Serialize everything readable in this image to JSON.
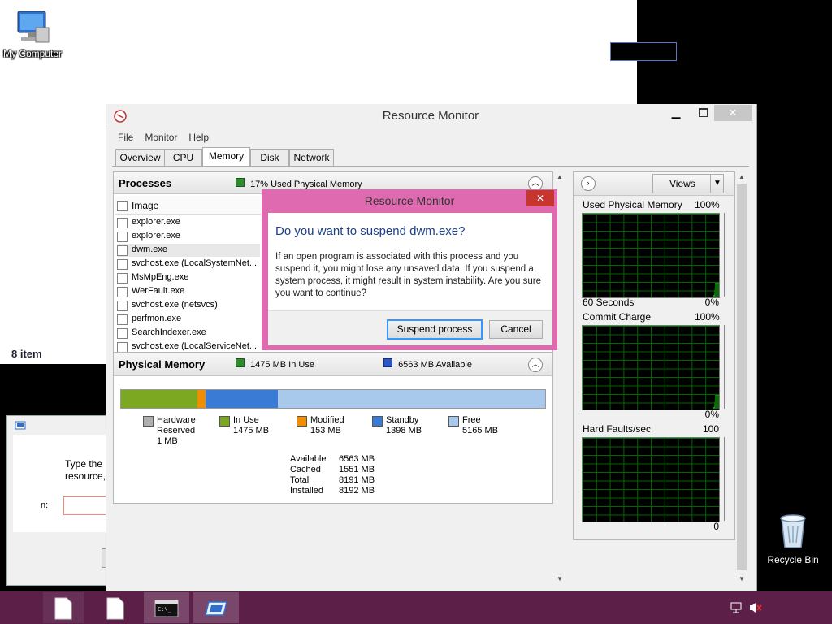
{
  "desktop": {
    "my_computer_label": "My Computer",
    "recycle_bin_label": "Recycle Bin",
    "status_text": "8 item",
    "run_dialog": {
      "prompt_line1": "Type the r",
      "prompt_line2": "resource,",
      "field_label": "n:"
    }
  },
  "window": {
    "title": "Resource Monitor",
    "menu": [
      "File",
      "Monitor",
      "Help"
    ],
    "tabs": [
      "Overview",
      "CPU",
      "Memory",
      "Disk",
      "Network"
    ],
    "active_tab": "Memory"
  },
  "processes": {
    "title": "Processes",
    "summary": "17% Used Physical Memory",
    "column_header": "Image",
    "rows": [
      "explorer.exe",
      "explorer.exe",
      "dwm.exe",
      "svchost.exe (LocalSystemNet...",
      "MsMpEng.exe",
      "WerFault.exe",
      "svchost.exe (netsvcs)",
      "perfmon.exe",
      "SearchIndexer.exe",
      "svchost.exe (LocalServiceNet..."
    ]
  },
  "physical_memory": {
    "title": "Physical Memory",
    "in_use_summary": "1475 MB In Use",
    "available_summary": "6563 MB Available",
    "bar": [
      {
        "label": "Hardware Reserved",
        "mb": 1,
        "color": "#a6a6a6"
      },
      {
        "label": "In Use",
        "mb": 1475,
        "color": "#7ba820"
      },
      {
        "label": "Modified",
        "mb": 153,
        "color": "#f28c00"
      },
      {
        "label": "Standby",
        "mb": 1398,
        "color": "#3a7bd5"
      },
      {
        "label": "Free",
        "mb": 5165,
        "color": "#a9c9ec"
      }
    ],
    "legend": [
      {
        "name": "Hardware\nReserved",
        "value": "1 MB",
        "color": "#b0b0b0"
      },
      {
        "name": "In Use",
        "value": "1475 MB",
        "color": "#7ba820"
      },
      {
        "name": "Modified",
        "value": "153 MB",
        "color": "#f28c00"
      },
      {
        "name": "Standby",
        "value": "1398 MB",
        "color": "#3a7bd5"
      },
      {
        "name": "Free",
        "value": "5165 MB",
        "color": "#a9c9ec"
      }
    ],
    "stats": [
      {
        "label": "Available",
        "value": "6563 MB"
      },
      {
        "label": "Cached",
        "value": "1551 MB"
      },
      {
        "label": "Total",
        "value": "8191 MB"
      },
      {
        "label": "Installed",
        "value": "8192 MB"
      }
    ]
  },
  "right_panel": {
    "views_label": "Views",
    "graphs": [
      {
        "title": "Used Physical Memory",
        "top_value": "100%",
        "bottom_left": "60 Seconds",
        "bottom_value": "0%"
      },
      {
        "title": "Commit Charge",
        "top_value": "100%",
        "bottom_left": "",
        "bottom_value": "0%"
      },
      {
        "title": "Hard Faults/sec",
        "top_value": "100",
        "bottom_left": "",
        "bottom_value": "0"
      }
    ]
  },
  "dialog": {
    "title": "Resource Monitor",
    "close": "✕",
    "heading": "Do you want to suspend dwm.exe?",
    "body": "If an open program is associated with this process and you suspend it, you might lose any unsaved data. If you suspend a system process, it might result in system instability. Are you sure you want to continue?",
    "confirm_label": "Suspend process",
    "cancel_label": "Cancel"
  },
  "colors": {
    "taskbar": "#5b1f48",
    "dialog_border": "#e06ab0",
    "graph_grid": "#006600",
    "graph_line": "#00cc00"
  }
}
